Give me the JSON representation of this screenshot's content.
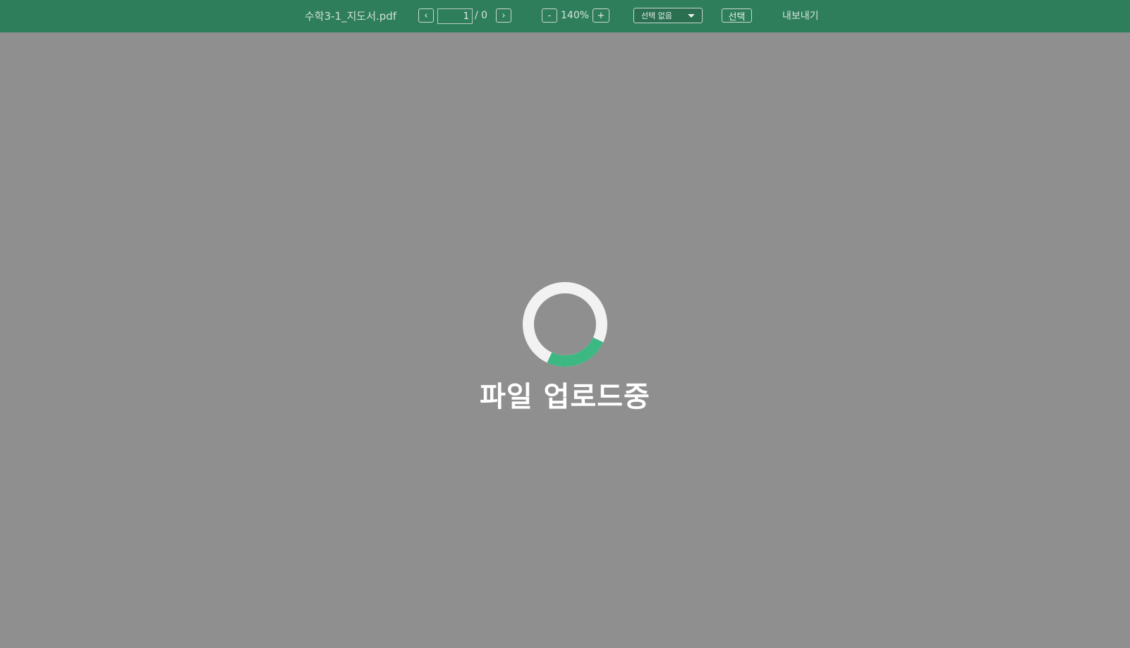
{
  "toolbar": {
    "filename": "수학3-1_지도서.pdf",
    "prev_icon": "chevron-left-icon",
    "next_icon": "chevron-right-icon",
    "page_current": "1",
    "page_total": "/ 0",
    "zoom_minus": "-",
    "zoom_level": "140%",
    "zoom_plus": "+",
    "select_value": "선택 없음",
    "select_button": "선택",
    "export_label": "내보내기"
  },
  "loading": {
    "message": "파일 업로드중",
    "progress_fraction": 0.25
  },
  "colors": {
    "toolbar_bg": "#2e7e5b",
    "page_bg": "#8f8f8f",
    "spinner_track": "#f2f2f2",
    "spinner_arc": "#3db883"
  }
}
